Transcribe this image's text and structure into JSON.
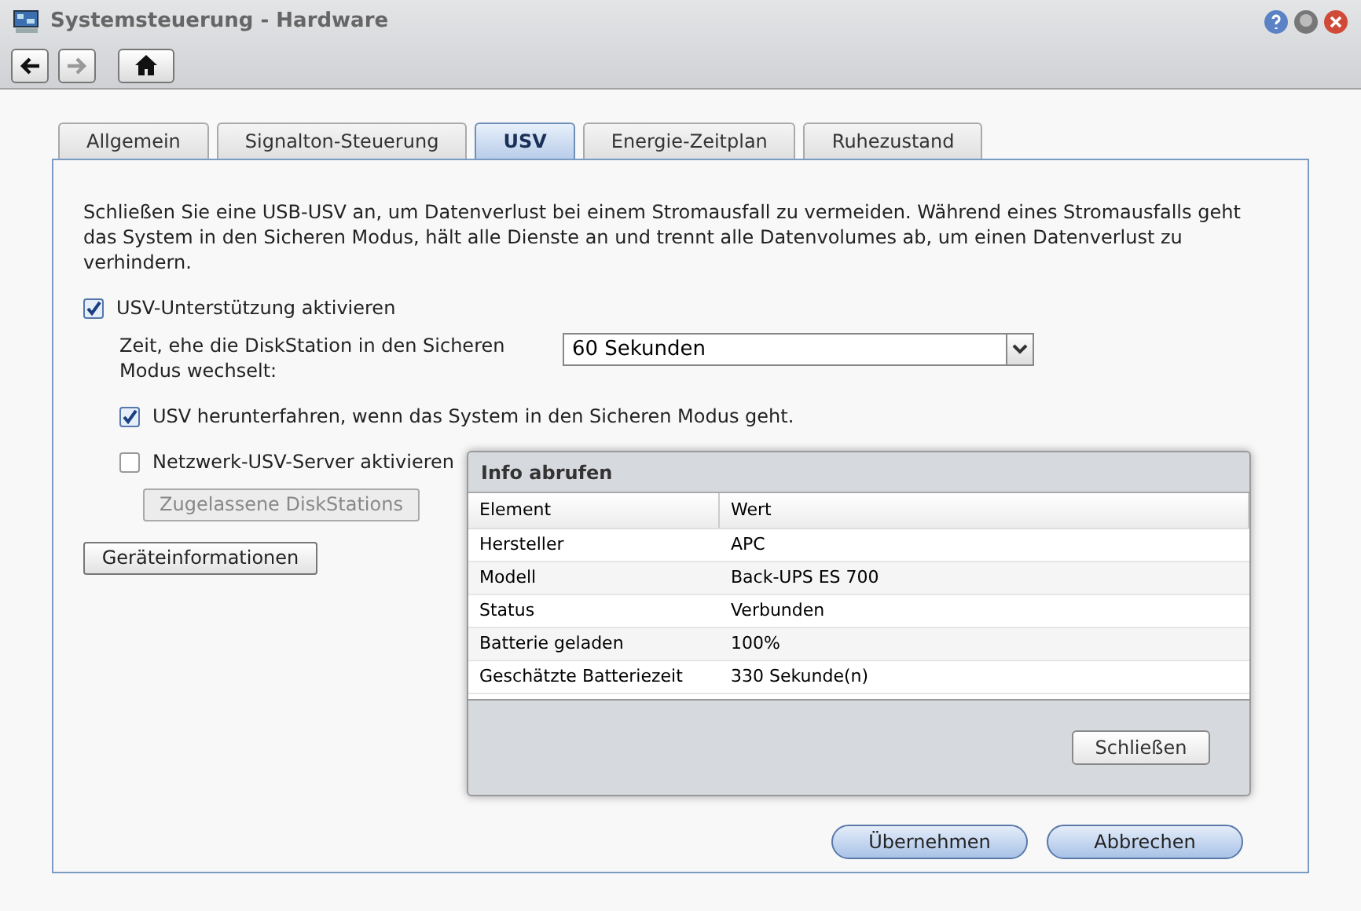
{
  "window": {
    "title": "Systemsteuerung - Hardware"
  },
  "tabs": [
    {
      "label": "Allgemein",
      "selected": false
    },
    {
      "label": "Signalton-Steuerung",
      "selected": false
    },
    {
      "label": "USV",
      "selected": true
    },
    {
      "label": "Energie-Zeitplan",
      "selected": false
    },
    {
      "label": "Ruhezustand",
      "selected": false
    }
  ],
  "description": "Schließen Sie eine USB-USV an, um Datenverlust bei einem Stromausfall zu vermeiden. Während eines Stromausfalls geht das System in den Sicheren Modus, hält alle Dienste an und trennt alle Datenvolumes ab, um einen Datenverlust zu verhindern.",
  "ups_support": {
    "label": "USV-Unterstützung aktivieren",
    "checked": true
  },
  "safe_mode_time": {
    "label": "Zeit, ehe die DiskStation in den Sicheren Modus wechselt:",
    "value": "60 Sekunden"
  },
  "shutdown_ups": {
    "label": "USV herunterfahren, wenn das System in den Sicheren Modus geht.",
    "checked": true
  },
  "network_ups": {
    "label": "Netzwerk-USV-Server aktivieren",
    "checked": false
  },
  "allowed_button": {
    "label": "Zugelassene DiskStations",
    "disabled": true
  },
  "device_info_button": "Geräteinformationen",
  "dialog": {
    "title": "Info abrufen",
    "columns": [
      "Element",
      "Wert"
    ],
    "rows": [
      [
        "Hersteller",
        "APC"
      ],
      [
        "Modell",
        "Back-UPS ES 700"
      ],
      [
        "Status",
        "Verbunden"
      ],
      [
        "Batterie geladen",
        "100%"
      ],
      [
        "Geschätzte Batteriezeit",
        "330 Sekunde(n)"
      ]
    ],
    "close_button": "Schließen"
  },
  "buttons": [
    "Übernehmen",
    "Abbrechen"
  ]
}
